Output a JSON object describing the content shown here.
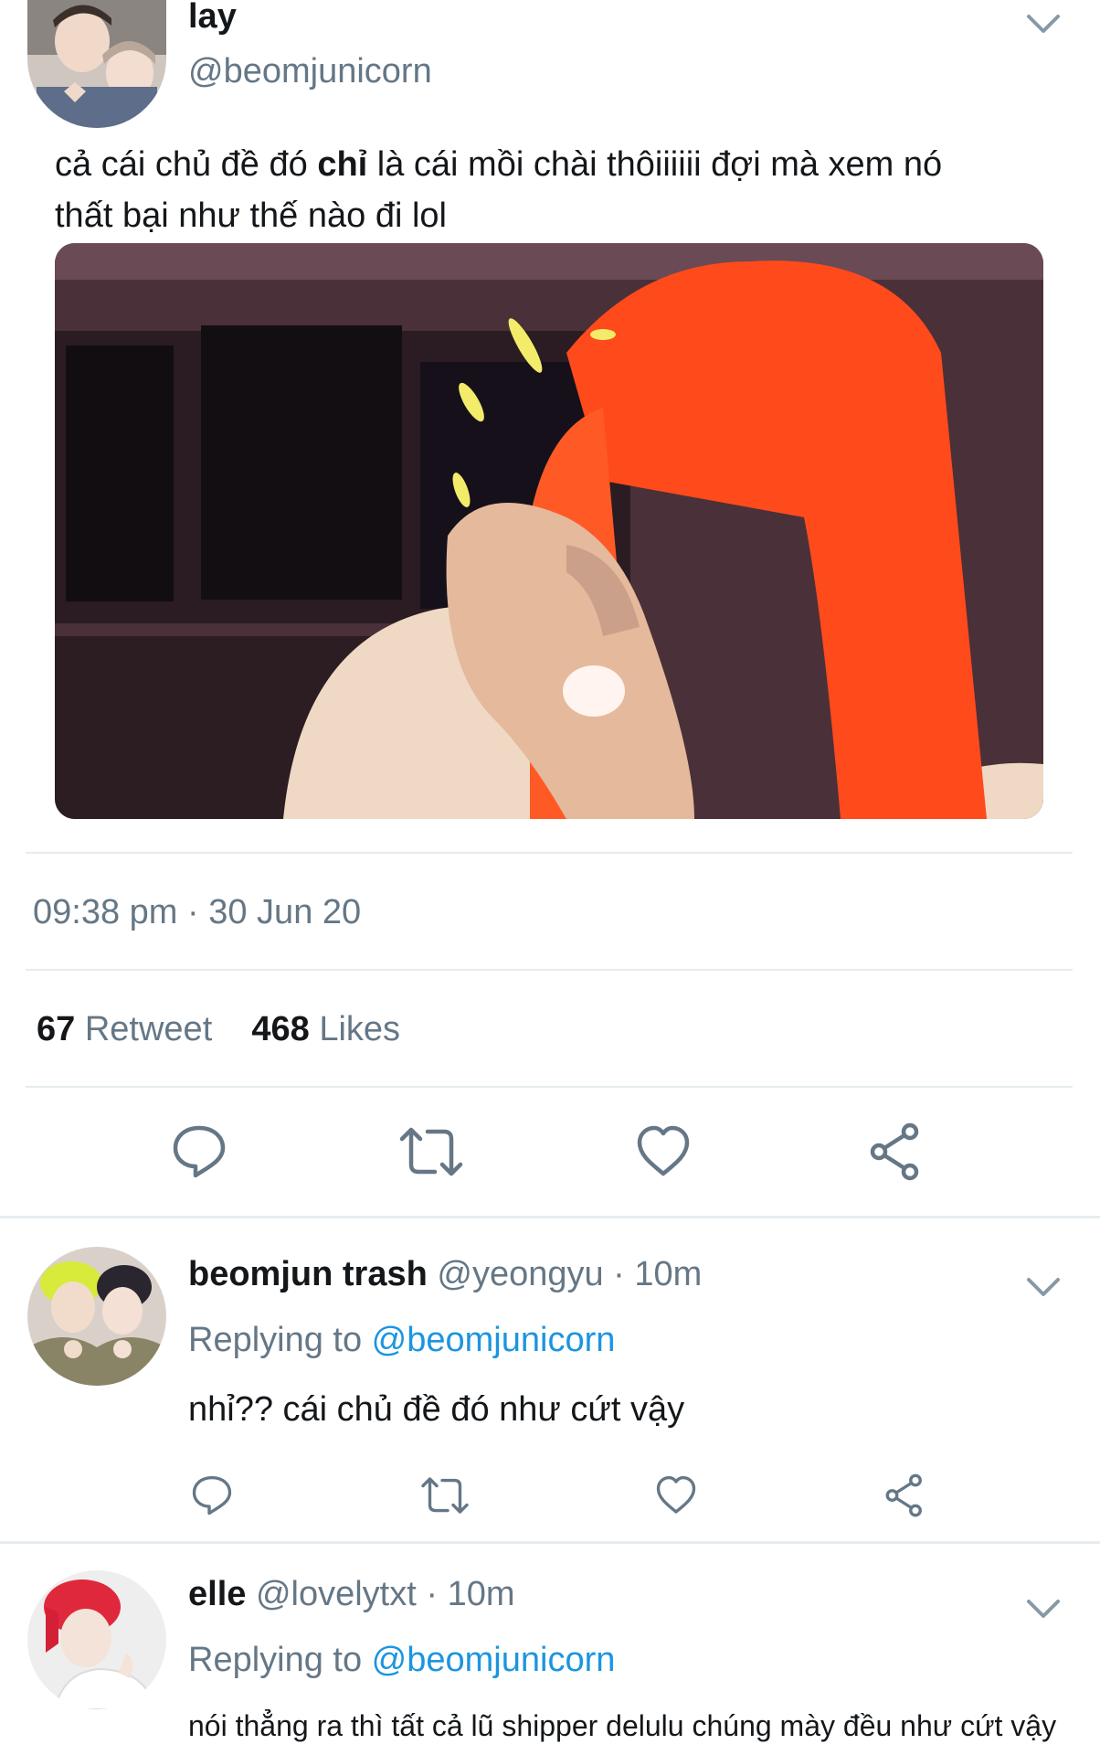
{
  "tweet": {
    "name": "lay",
    "handle": "@beomjunicorn",
    "text_parts": [
      "cả cái chủ đề đó ",
      "chỉ",
      "  là cái mồi chài thôiiiiii đợi mà xem nó",
      "thất bại như thế nào đi lol"
    ],
    "time": "09:38 pm",
    "sep": " · ",
    "date": "30 Jun 20",
    "retweets": "67",
    "retweets_label": "Retweet",
    "likes": "468",
    "likes_label": "Likes"
  },
  "replies": [
    {
      "name": "beomjun trash",
      "handle": "@yeongyu",
      "sep": " · ",
      "time": "10m",
      "replying_label": "Replying to ",
      "replying_to": "@beomjunicorn",
      "text": "nhỉ?? cái chủ đề đó như cứt vậy"
    },
    {
      "name": "elle",
      "handle": "@lovelytxt",
      "sep": " · ",
      "time": "10m",
      "replying_label": "Replying to ",
      "replying_to": "@beomjunicorn",
      "text": "nói thẳng ra thì tất cả lũ shipper delulu chúng mày đều như cứt vậy"
    }
  ],
  "colors": {
    "link": "#1b95e0",
    "muted": "#657786",
    "text": "#14171a",
    "divider": "#e6ecf0",
    "hair": "#ff4a1c"
  }
}
